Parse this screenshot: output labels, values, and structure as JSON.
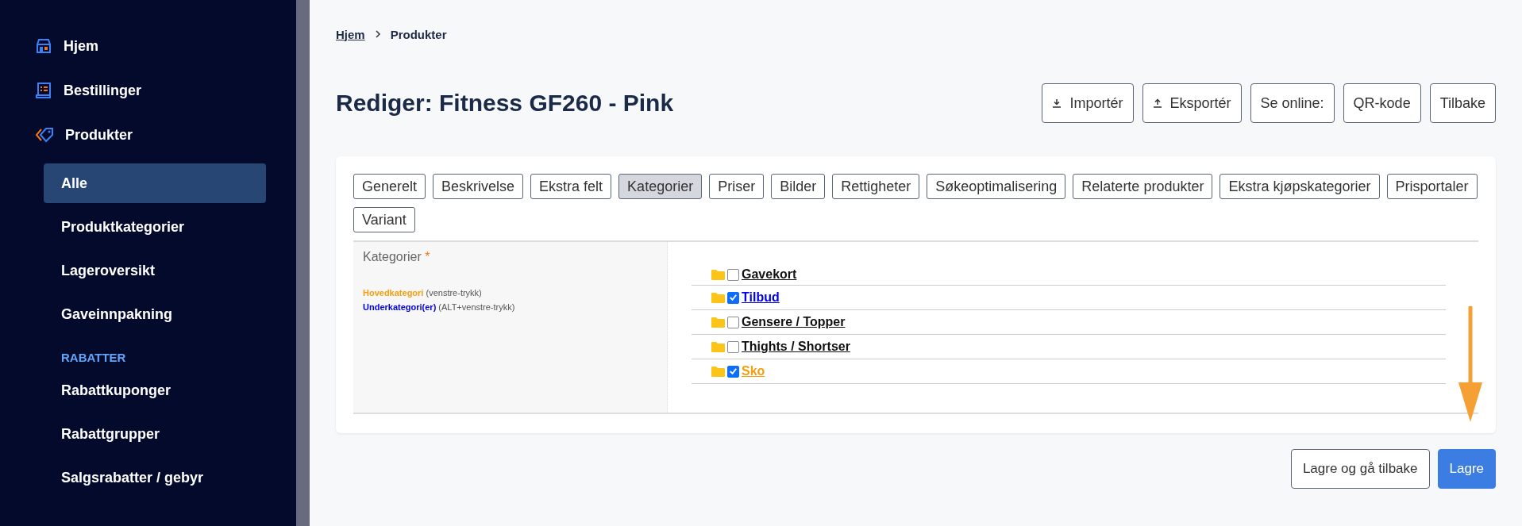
{
  "sidebar": {
    "items": [
      {
        "label": "Hjem",
        "selected": false,
        "kind": "top"
      },
      {
        "label": "Bestillinger",
        "selected": false,
        "kind": "top"
      },
      {
        "label": "Produkter",
        "selected": false,
        "kind": "top"
      },
      {
        "label": "Alle",
        "selected": true,
        "kind": "sub"
      },
      {
        "label": "Produktkategorier",
        "selected": false,
        "kind": "sub"
      },
      {
        "label": "Lageroversikt",
        "selected": false,
        "kind": "sub"
      },
      {
        "label": "Gaveinnpakning",
        "selected": false,
        "kind": "sub"
      },
      {
        "label": "RABATTER",
        "kind": "header"
      },
      {
        "label": "Rabattkuponger",
        "selected": false,
        "kind": "sub"
      },
      {
        "label": "Rabattgrupper",
        "selected": false,
        "kind": "sub"
      },
      {
        "label": "Salgsrabatter / gebyr",
        "selected": false,
        "kind": "sub"
      }
    ]
  },
  "breadcrumb": [
    {
      "label": "Hjem",
      "kind": "link"
    },
    {
      "label": "Produkter",
      "kind": "current"
    }
  ],
  "title": "Rediger: Fitness GF260 - Pink",
  "header_buttons": [
    {
      "label": "Importér",
      "kind": "import"
    },
    {
      "label": "Eksportér",
      "kind": "export"
    },
    {
      "label": "Se online:"
    },
    {
      "label": "QR-kode"
    },
    {
      "label": "Tilbake"
    }
  ],
  "tabs": [
    {
      "label": "Generelt",
      "selected": false
    },
    {
      "label": "Beskrivelse",
      "selected": false
    },
    {
      "label": "Ekstra felt",
      "selected": false
    },
    {
      "label": "Kategorier",
      "selected": true
    },
    {
      "label": "Priser",
      "selected": false
    },
    {
      "label": "Bilder",
      "selected": false
    },
    {
      "label": "Rettigheter",
      "selected": false
    },
    {
      "label": "Søkeoptimalisering",
      "selected": false
    },
    {
      "label": "Relaterte produkter",
      "selected": false
    },
    {
      "label": "Ekstra kjøpskategorier",
      "selected": false
    },
    {
      "label": "Prisportaler",
      "selected": false
    },
    {
      "label": "Variant",
      "selected": false
    }
  ],
  "field": {
    "label": "Kategorier",
    "required_mark": "*",
    "legend": [
      {
        "kind": "main",
        "term": "Hovedkategori",
        "hint": "(venstre-trykk)"
      },
      {
        "kind": "sub",
        "term": "Underkategori(er)",
        "hint": "(ALT+venstre-trykk)"
      }
    ]
  },
  "categories": [
    {
      "label": "Gavekort",
      "checked": false,
      "kind": "plain"
    },
    {
      "label": "Tilbud",
      "checked": true,
      "kind": "sub"
    },
    {
      "label": "Gensere / Topper",
      "checked": false,
      "kind": "plain"
    },
    {
      "label": "Thights / Shortser",
      "checked": false,
      "kind": "plain"
    },
    {
      "label": "Sko",
      "checked": true,
      "kind": "main"
    }
  ],
  "footer_buttons": [
    {
      "label": "Lagre og gå tilbake",
      "kind": "secondary"
    },
    {
      "label": "Lagre",
      "kind": "primary"
    }
  ]
}
